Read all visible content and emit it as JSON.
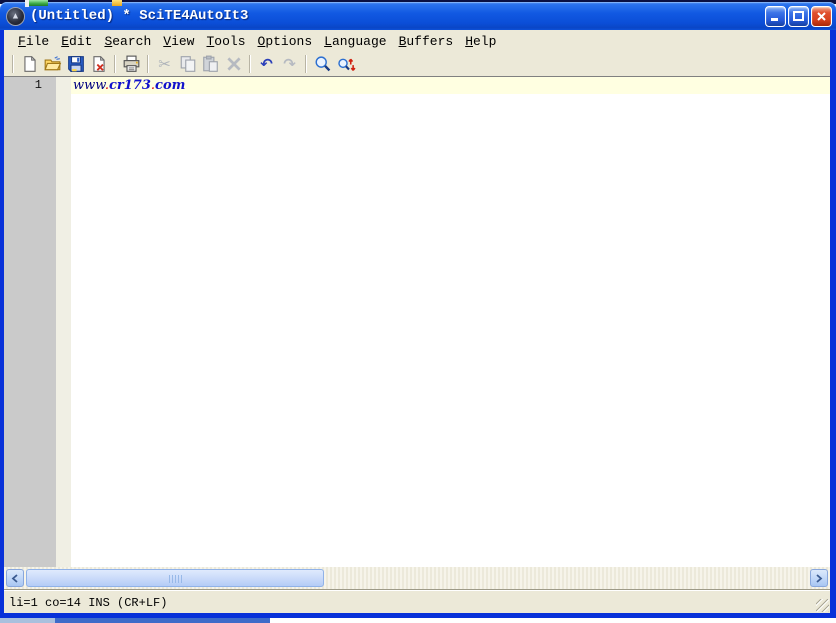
{
  "window": {
    "title": "(Untitled) * SciTE4AutoIt3",
    "icon": "autoit-logo-icon"
  },
  "titlebar": {
    "buttons": [
      "minimize",
      "maximize",
      "close"
    ]
  },
  "menubar": {
    "items": [
      {
        "label": "File"
      },
      {
        "label": "Edit"
      },
      {
        "label": "Search"
      },
      {
        "label": "View"
      },
      {
        "label": "Tools"
      },
      {
        "label": "Options"
      },
      {
        "label": "Language"
      },
      {
        "label": "Buffers"
      },
      {
        "label": "Help"
      }
    ]
  },
  "toolbar": {
    "buttons": [
      {
        "icon": "new-document-icon",
        "enabled": true
      },
      {
        "icon": "open-folder-icon",
        "enabled": true
      },
      {
        "icon": "save-icon",
        "enabled": true
      },
      {
        "icon": "close-file-icon",
        "enabled": true
      },
      {
        "icon": "print-icon",
        "enabled": true
      },
      {
        "icon": "cut-icon",
        "enabled": false
      },
      {
        "icon": "copy-icon",
        "enabled": false
      },
      {
        "icon": "paste-icon",
        "enabled": false
      },
      {
        "icon": "delete-icon",
        "enabled": false
      },
      {
        "icon": "undo-icon",
        "enabled": true
      },
      {
        "icon": "redo-icon",
        "enabled": false
      },
      {
        "icon": "find-icon",
        "enabled": true
      },
      {
        "icon": "replace-icon",
        "enabled": true
      }
    ]
  },
  "editor": {
    "line_number": "1",
    "tokens": [
      {
        "text": "www",
        "color": "#000080",
        "style": "italic"
      },
      {
        "text": ".",
        "color": "#E00000",
        "style": "italic"
      },
      {
        "text": "cr173",
        "color": "#1111CC",
        "style": "bold-italic"
      },
      {
        "text": ".",
        "color": "#E00000",
        "style": "italic"
      },
      {
        "text": "com",
        "color": "#1111CC",
        "style": "bold-italic"
      }
    ],
    "caret_line_color": "#FFFFE1"
  },
  "statusbar": {
    "text": "li=1 co=14 INS (CR+LF)"
  },
  "colors": {
    "titlebar_blue": "#1159E2",
    "window_border": "#0831D9",
    "chrome_background": "#ECE9D8",
    "close_button_red": "#D8431F",
    "line_margin_gray": "#CACACA",
    "fold_margin_cream": "#F0EFE4",
    "scroll_thumb_blue": "#CDDDFA"
  }
}
